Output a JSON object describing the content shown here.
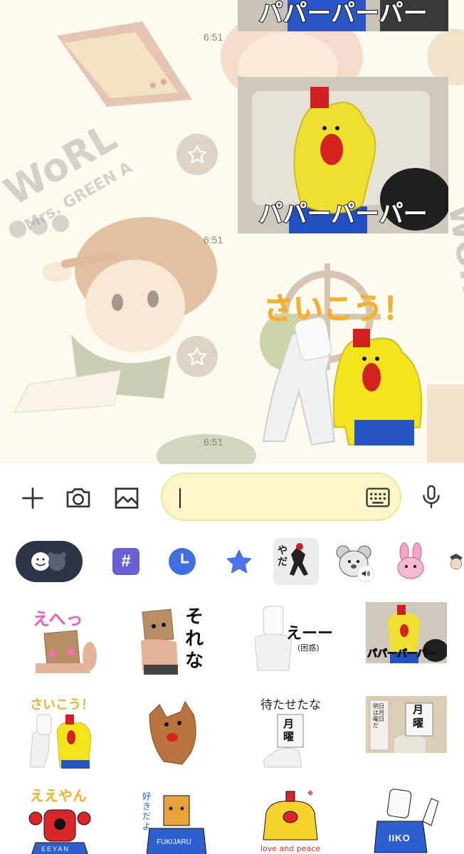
{
  "chat": {
    "timestamps": [
      "6:51",
      "6:51",
      "6:51"
    ],
    "messages": [
      {
        "type": "sticker",
        "caption": "パパーパーパー"
      },
      {
        "type": "sticker",
        "caption": "パパーパーパー"
      },
      {
        "type": "sticker",
        "caption": "さいこう！"
      }
    ],
    "wallpaper_text": "Mrs. GREEN APPLE WORLD"
  },
  "input_bar": {
    "add_icon": "plus-icon",
    "camera_icon": "camera-icon",
    "gallery_icon": "image-icon",
    "message_value": "",
    "keyboard_icon": "keyboard-icon",
    "mic_icon": "microphone-icon"
  },
  "sticker_tabs": [
    {
      "icon": "emoji-toggle-icon",
      "selected": false
    },
    {
      "icon": "hashtag-icon",
      "label": "#"
    },
    {
      "icon": "recent-clock-icon"
    },
    {
      "icon": "favorite-star-icon"
    },
    {
      "icon": "sticker-pack-figure-icon",
      "selected": true,
      "label": "やだ"
    },
    {
      "icon": "sticker-pack-mouse-icon",
      "sound": true
    },
    {
      "icon": "sticker-pack-bunny-icon"
    },
    {
      "icon": "sticker-pack-character-icon"
    }
  ],
  "stickers": [
    {
      "text": "えへっ"
    },
    {
      "text": "それな"
    },
    {
      "text": "えーー",
      "sub": "(困惑)"
    },
    {
      "text": "パパーパーパー"
    },
    {
      "text": "さいこう！"
    },
    {
      "text": ""
    },
    {
      "text": "待たせたな",
      "sub": "月曜"
    },
    {
      "text": "月曜",
      "sub": "明日は月曜日だ"
    },
    {
      "text": "ええやん",
      "sub": "EEYAN"
    },
    {
      "text": "好きだよ",
      "sub": "FUKIJARU"
    },
    {
      "text": "love and peace"
    },
    {
      "text": "IIKO"
    }
  ],
  "colors": {
    "chat_bg": "#fdfaef",
    "field_bg": "#fbf5c8",
    "accent_blue": "#4a73e8",
    "hashtag_purple": "#6a5fd6"
  }
}
